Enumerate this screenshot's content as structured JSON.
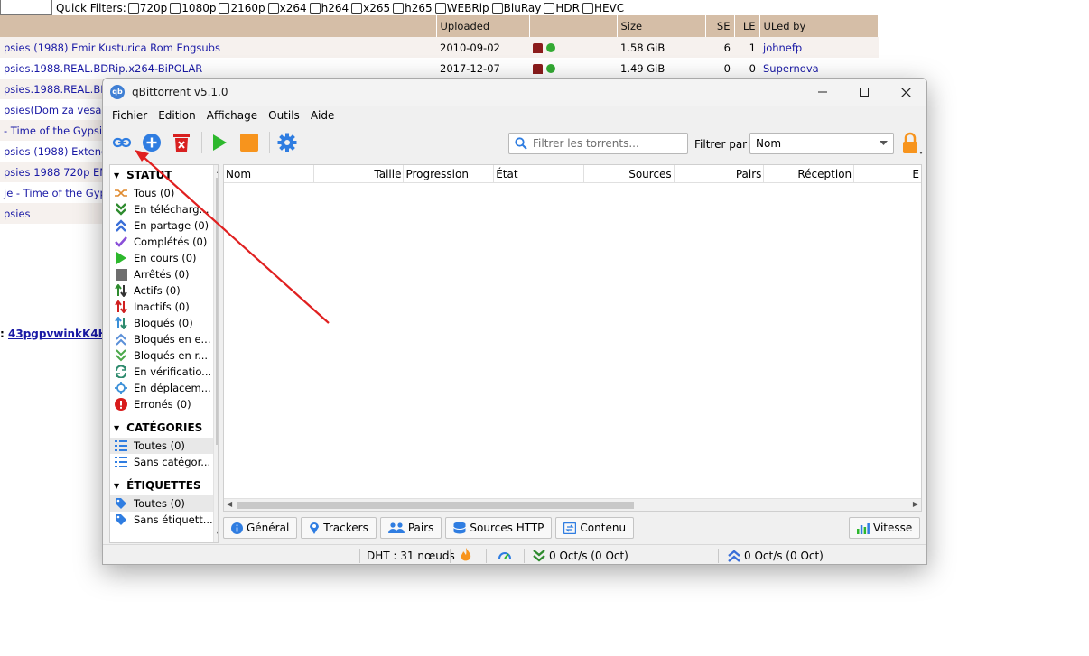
{
  "quick_filters": {
    "label": "Quick Filters:",
    "options": [
      "720p",
      "1080p",
      "2160p",
      "x264",
      "h264",
      "x265",
      "h265",
      "WEBRip",
      "BluRay",
      "HDR",
      "HEVC"
    ]
  },
  "results": {
    "headers": [
      "",
      "Uploaded",
      "",
      "Size",
      "SE",
      "LE",
      "ULed by"
    ],
    "rows": [
      {
        "name": "psies (1988) Emir Kusturica Rom Engsubs",
        "uploaded": "2010-09-02",
        "size": "1.58 GiB",
        "se": "6",
        "le": "1",
        "user": "johnefp"
      },
      {
        "name": "psies.1988.REAL.BDRip.x264-BiPOLAR",
        "uploaded": "2017-12-07",
        "size": "1.49 GiB",
        "se": "0",
        "le": "0",
        "user": "Supernova"
      },
      {
        "name": "psies.1988.REAL.BD",
        "uploaded": "",
        "size": "",
        "se": "",
        "le": "",
        "user": ""
      },
      {
        "name": "psies(Dom za vesan",
        "uploaded": "",
        "size": "",
        "se": "",
        "le": "",
        "user": ""
      },
      {
        "name": "- Time of the Gypsi",
        "uploaded": "",
        "size": "",
        "se": "",
        "le": "",
        "user": ""
      },
      {
        "name": "psies (1988) Extend",
        "uploaded": "",
        "size": "",
        "se": "",
        "le": "",
        "user": ""
      },
      {
        "name": "psies 1988 720p EN",
        "uploaded": "",
        "size": "",
        "se": "",
        "le": "",
        "user": ""
      },
      {
        "name": "je - Time of the Gyp",
        "uploaded": "",
        "size": "",
        "se": "",
        "le": "",
        "user": ""
      },
      {
        "name": "psies",
        "uploaded": "",
        "size": "",
        "se": "",
        "le": "",
        "user": ""
      }
    ],
    "hash_prefix": ":",
    "hash_link": "43pgpvwinkK4H"
  },
  "window": {
    "title": "qBittorrent v5.1.0",
    "controls": {
      "minimize": "—",
      "maximize": "☐",
      "close": "✕"
    }
  },
  "menu": [
    "Fichier",
    "Edition",
    "Affichage",
    "Outils",
    "Aide"
  ],
  "toolbar": {
    "search_placeholder": "Filtrer les torrents...",
    "filter_label": "Filtrer par :",
    "filter_value": "Nom"
  },
  "sidebar": {
    "status_header": "STATUT",
    "status_items": [
      {
        "label": "Tous (0)",
        "icon": "shuffle-icon",
        "color": "#e08a2e"
      },
      {
        "label": "En télécharg...",
        "icon": "download-icon",
        "color": "#2e8b2e"
      },
      {
        "label": "En partage (0)",
        "icon": "upload-icon",
        "color": "#3a6fd8"
      },
      {
        "label": "Complétés (0)",
        "icon": "check-icon",
        "color": "#8a4fd8"
      },
      {
        "label": "En cours (0)",
        "icon": "play-icon",
        "color": "#2db82d"
      },
      {
        "label": "Arrêtés (0)",
        "icon": "stop-icon",
        "color": "#6e6e6e"
      },
      {
        "label": "Actifs (0)",
        "icon": "active-icon",
        "color": "#2e8b2e"
      },
      {
        "label": "Inactifs (0)",
        "icon": "inactive-icon",
        "color": "#d02020"
      },
      {
        "label": "Bloqués (0)",
        "icon": "stalled-icon",
        "color": "#2e8b8b"
      },
      {
        "label": "Bloqués en e...",
        "icon": "stalled-upload-icon",
        "color": "#5a8fd8"
      },
      {
        "label": "Bloqués en r...",
        "icon": "stalled-download-icon",
        "color": "#4aa84a"
      },
      {
        "label": "En vérificatio...",
        "icon": "checking-icon",
        "color": "#2e8b6e"
      },
      {
        "label": "En déplacem...",
        "icon": "moving-icon",
        "color": "#3a8fd8"
      },
      {
        "label": "Erronés (0)",
        "icon": "error-icon",
        "color": "#d81b1b"
      }
    ],
    "categories_header": "CATÉGORIES",
    "category_items": [
      {
        "label": "Toutes (0)"
      },
      {
        "label": "Sans catégor..."
      }
    ],
    "tags_header": "ÉTIQUETTES",
    "tag_items": [
      {
        "label": "Toutes (0)"
      },
      {
        "label": "Sans étiquett..."
      }
    ]
  },
  "columns": [
    "Nom",
    "Taille",
    "Progression",
    "État",
    "Sources",
    "Pairs",
    "Réception",
    "E"
  ],
  "bottom_tabs": [
    "Général",
    "Trackers",
    "Pairs",
    "Sources HTTP",
    "Contenu"
  ],
  "speed_tab": "Vitesse",
  "status_bar": {
    "dht": "DHT : 31 nœuds",
    "download": "0 Oct/s (0 Oct)",
    "upload": "0 Oct/s (0 Oct)"
  },
  "colors": {
    "accent_blue": "#2f7de1",
    "play_green": "#2db82d",
    "stop_orange": "#f7941d",
    "delete_red": "#d82020",
    "annotation_red": "#e02020",
    "table_header": "#d5bea7"
  }
}
